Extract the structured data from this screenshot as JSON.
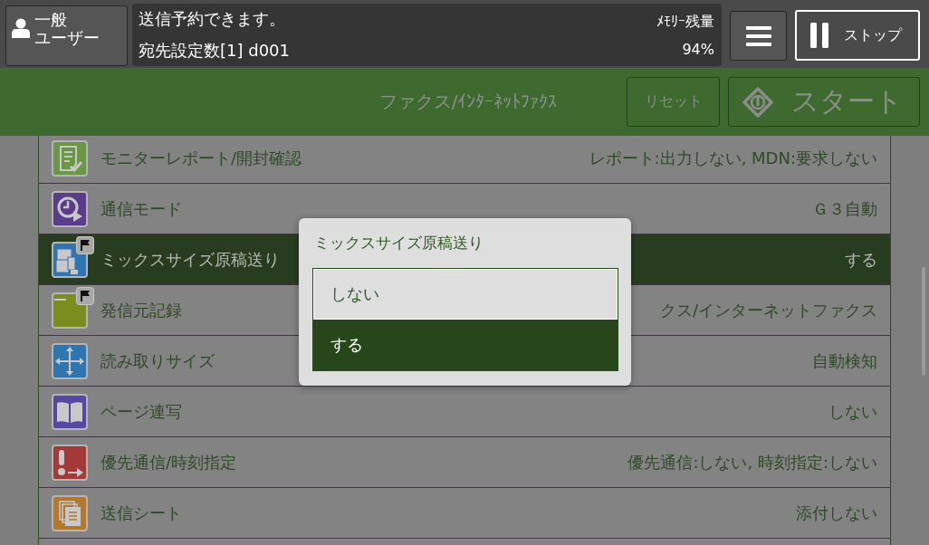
{
  "header": {
    "user_button": {
      "label_lines": [
        "一般",
        "ユーザー"
      ]
    },
    "status_messages": [
      "送信予約できます。",
      "宛先設定数[1] d001"
    ],
    "memory": {
      "label": "ﾒﾓﾘｰ残量",
      "value": "94%"
    },
    "stop_button": {
      "label": "ストップ"
    }
  },
  "title_bar": {
    "title": "ファクス/ｲﾝﾀｰﾈｯﾄﾌｧｸｽ",
    "reset_button": {
      "label": "リセット",
      "disabled": true
    },
    "start_button": {
      "label": "スタート",
      "disabled": true
    }
  },
  "settings": [
    {
      "label": "モニターレポート/開封確認",
      "value": "レポート:出力しない, MDN:要求しない",
      "flagged": false,
      "selected": false
    },
    {
      "label": "通信モード",
      "value": "Ｇ３自動",
      "flagged": false,
      "selected": false
    },
    {
      "label": "ミックスサイズ原稿送り",
      "value": "する",
      "flagged": true,
      "selected": true
    },
    {
      "label": "発信元記録",
      "value": "クス/インターネットファクス",
      "flagged": true,
      "selected": false
    },
    {
      "label": "読み取りサイズ",
      "value": "自動検知",
      "flagged": false,
      "selected": false
    },
    {
      "label": "ページ連写",
      "value": "しない",
      "flagged": false,
      "selected": false
    },
    {
      "label": "優先通信/時刻指定",
      "value": "優先通信:しない, 時刻指定:しない",
      "flagged": false,
      "selected": false
    },
    {
      "label": "送信シート",
      "value": "添付しない",
      "flagged": false,
      "selected": false
    }
  ],
  "dialog": {
    "title": "ミックスサイズ原稿送り",
    "options": [
      {
        "label": "しない",
        "selected": false
      },
      {
        "label": "する",
        "selected": true
      }
    ]
  }
}
